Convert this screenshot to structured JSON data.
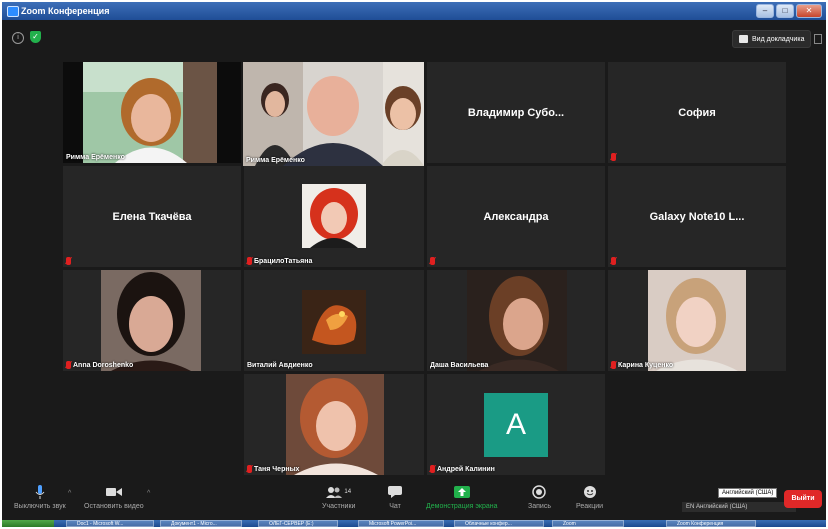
{
  "window": {
    "title": "Zoom Конференция"
  },
  "topbar": {
    "speaker_view_label": "Вид докладчика"
  },
  "tiles": [
    {
      "label": "Римма Ерёменко"
    },
    {
      "label": "Римма Ерёменко"
    },
    {
      "name": "Владимир  Субо..."
    },
    {
      "name": "София"
    },
    {
      "name": "Елена Ткачёва"
    },
    {
      "label": "БрацилоТатьяна"
    },
    {
      "name": "Александра"
    },
    {
      "name": "Galaxy Note10 L..."
    },
    {
      "label": "Anna Doroshenko"
    },
    {
      "label": "Виталий Авдиенко"
    },
    {
      "label": "Даша Васильева"
    },
    {
      "label": "Карина Куценко"
    },
    {
      "label": "Таня Черных"
    },
    {
      "label": "Андрей Калинин",
      "avatar_letter": "A",
      "avatar_color": "#1a9b85"
    }
  ],
  "toolbar": {
    "mute": "Выключить звук",
    "video": "Остановить видео",
    "participants": "Участники",
    "participants_count": "14",
    "chat": "Чат",
    "share": "Демонстрация экрана",
    "record": "Запись",
    "reactions": "Реакции",
    "leave": "Выйти"
  },
  "language": {
    "tooltip": "Английский (США)",
    "bar": "EN Английский (США)"
  },
  "taskbar": [
    "Doc1 - Microsoft W...",
    "Документ1 - Micro...",
    "ОЛЕГ-СЕРВЕР (E:)",
    "Microsoft PowerPoi...",
    "Облачные конфер...",
    "Zoom",
    "Zoom Конференция"
  ],
  "colors": {
    "active_speaker": "#c9d93b",
    "share_green": "#22b14c",
    "leave_red": "#e02828"
  }
}
